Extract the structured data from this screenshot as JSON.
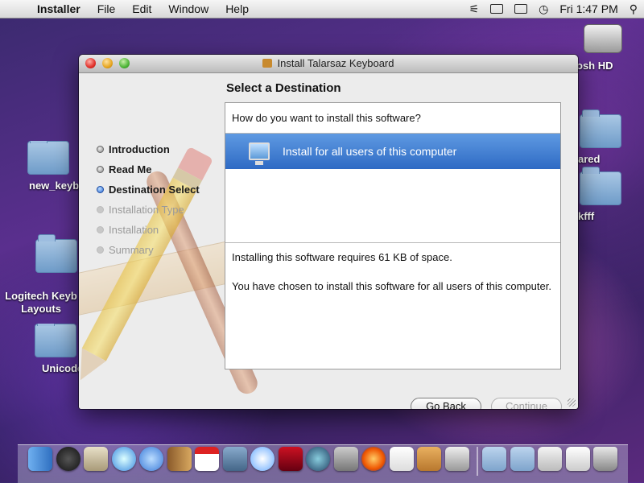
{
  "menubar": {
    "app_name": "Installer",
    "items": [
      "File",
      "Edit",
      "Window",
      "Help"
    ],
    "clock": "Fri 1:47 PM"
  },
  "desktop_icons": [
    {
      "label": "osh HD"
    },
    {
      "label": "new_keyb"
    },
    {
      "label": "ared"
    },
    {
      "label": "kfff"
    },
    {
      "label": "Logitech Keyb\nLayouts"
    },
    {
      "label": "Unicode"
    }
  ],
  "window": {
    "title": "Install Talarsaz Keyboard",
    "heading": "Select a Destination",
    "steps": [
      {
        "label": "Introduction",
        "state": "done"
      },
      {
        "label": "Read Me",
        "state": "done"
      },
      {
        "label": "Destination Select",
        "state": "active"
      },
      {
        "label": "Installation Type",
        "state": "disabled"
      },
      {
        "label": "Installation",
        "state": "disabled"
      },
      {
        "label": "Summary",
        "state": "disabled"
      }
    ],
    "question": "How do you want to install this software?",
    "option": "Install for all users of this computer",
    "info_space": "Installing this software requires 61 KB of space.",
    "info_choice": "You have chosen to install this software for all users of this computer.",
    "go_back_label": "Go Back",
    "continue_label": "Continue"
  },
  "dock_icons": [
    "finder-icon",
    "dashboard-icon",
    "mail-icon",
    "safari-icon",
    "ichat-icon",
    "address-book-icon",
    "ical-icon",
    "iphoto-icon",
    "itunes-icon",
    "photo-booth-icon",
    "time-machine-icon",
    "system-preferences-icon",
    "firefox-icon",
    "textedit-icon",
    "installer-icon",
    "disk-utility-icon",
    "applications-folder-icon",
    "documents-folder-icon",
    "downloads-icon",
    "preview-icon",
    "trash-icon"
  ],
  "colors": {
    "selection": "#2e6ac4",
    "window_bg": "#ececec"
  }
}
